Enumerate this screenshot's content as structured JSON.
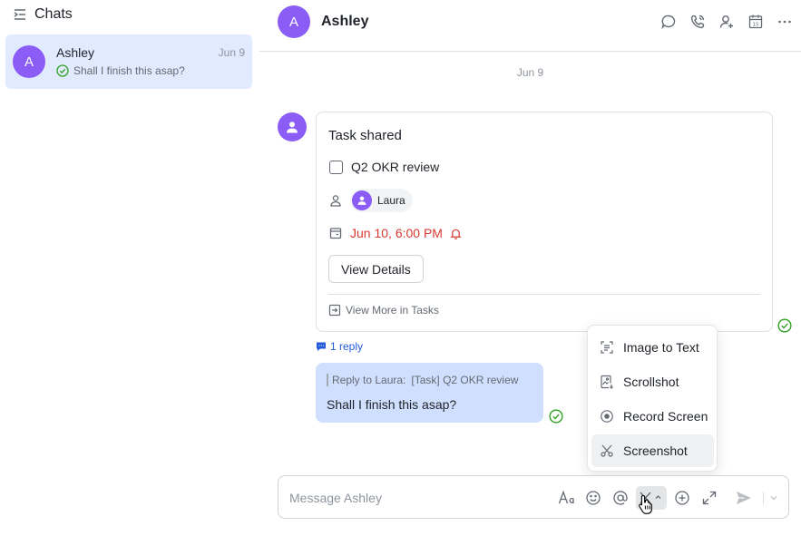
{
  "sidebar": {
    "title": "Chats",
    "chats": [
      {
        "initial": "A",
        "name": "Ashley",
        "date": "Jun 9",
        "preview": "Shall I finish this asap?"
      }
    ]
  },
  "header": {
    "initial": "A",
    "name": "Ashley",
    "actions": [
      "search-chat-icon",
      "call-icon",
      "add-member-icon",
      "calendar-icon",
      "more-icon"
    ]
  },
  "conversation": {
    "date_separator": "Jun 9",
    "task_card": {
      "title": "Task shared",
      "task_name": "Q2 OKR review",
      "assignee": "Laura",
      "due": "Jun 10, 6:00 PM",
      "view_details": "View Details",
      "view_more": "View More in Tasks"
    },
    "reply_count": "1 reply",
    "reply_message": {
      "quote_prefix": "Reply to Laura:",
      "quote_text": "[Task] Q2 OKR review",
      "text": "Shall I finish this asap?"
    }
  },
  "screenshot_menu": {
    "items": [
      {
        "label": "Image to Text",
        "icon": "image-to-text-icon"
      },
      {
        "label": "Scrollshot",
        "icon": "scrollshot-icon"
      },
      {
        "label": "Record Screen",
        "icon": "record-icon"
      },
      {
        "label": "Screenshot",
        "icon": "scissors-icon"
      }
    ]
  },
  "composer": {
    "placeholder": "Message Ashley",
    "tools": [
      "format-icon",
      "emoji-icon",
      "mention-icon",
      "screenshot-icon",
      "add-icon",
      "expand-icon",
      "send-icon",
      "send-options-icon"
    ]
  },
  "colors": {
    "accent": "#245bdb",
    "avatar": "#8b5cf6",
    "selected_chat": "#e1eaff",
    "my_bubble": "#cfdffd",
    "due_red": "#d83931",
    "read_green": "#2ea121"
  }
}
